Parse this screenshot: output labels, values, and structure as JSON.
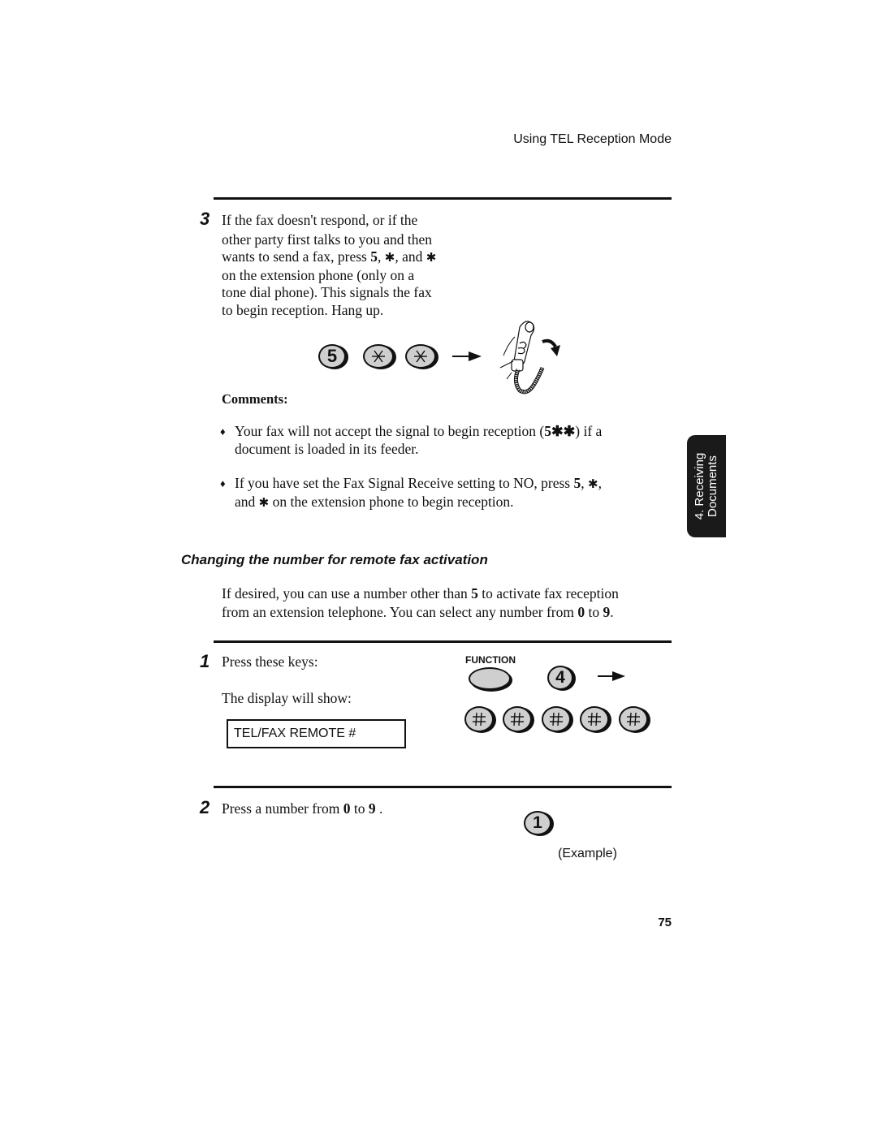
{
  "header": {
    "running_head": "Using TEL Reception Mode"
  },
  "side_tab": {
    "line1": "4. Receiving",
    "line2": "Documents"
  },
  "step3": {
    "number": "3",
    "lines": [
      "If the fax doesn't respond, or if the",
      "other party first talks to you and then"
    ],
    "line3_pre": "wants to send a fax, press ",
    "line3_key1": "5",
    "line3_sep1": ", ",
    "line3_star1": "✱",
    "line3_sep2": ", and ",
    "line3_star2": "✱",
    "lines_after": [
      "on the extension phone (only on a",
      "tone dial phone). This signals the fax",
      "to begin reception. Hang up."
    ],
    "keys": [
      "5",
      "*",
      "*"
    ],
    "illustration": "hang-up-handset"
  },
  "comments": {
    "heading": "Comments:",
    "bullet_glyph": "♦",
    "bullet1_pre": "Your fax will not accept the signal to begin reception (",
    "bullet1_code": "5✱✱",
    "bullet1_post": ") if a",
    "bullet1_line2": "document is loaded in its feeder.",
    "bullet2_pre": "If you have set the Fax Signal Receive setting to NO, press ",
    "bullet2_key": "5",
    "bullet2_sep": ", ",
    "bullet2_star1": "✱",
    "bullet2_end1": ",",
    "bullet2_line2_pre": "and ",
    "bullet2_star2": "✱",
    "bullet2_line2_post": " on the extension phone to begin reception."
  },
  "section": {
    "heading": "Changing the number for remote fax activation",
    "intro_pre": "If desired, you can use a number other than ",
    "intro_num": "5",
    "intro_mid": " to activate fax reception",
    "intro_line2_pre": "from an extension telephone. You can select any number from ",
    "intro_from": "0",
    "intro_to_word": " to ",
    "intro_to": "9",
    "intro_end": "."
  },
  "step1": {
    "number": "1",
    "instruction": "Press these keys:",
    "display_label": "The display will show:",
    "display_text": "TEL/FAX REMOTE #",
    "function_label": "FUNCTION",
    "key_digit": "4",
    "hash_keys": [
      "#",
      "#",
      "#",
      "#",
      "#"
    ]
  },
  "step2": {
    "number": "2",
    "pre": "Press a number from ",
    "from": "0",
    "mid": " to ",
    "to": "9",
    "end": " .",
    "example_key": "1",
    "example_label": "(Example)"
  },
  "footer": {
    "page_number": "75"
  }
}
